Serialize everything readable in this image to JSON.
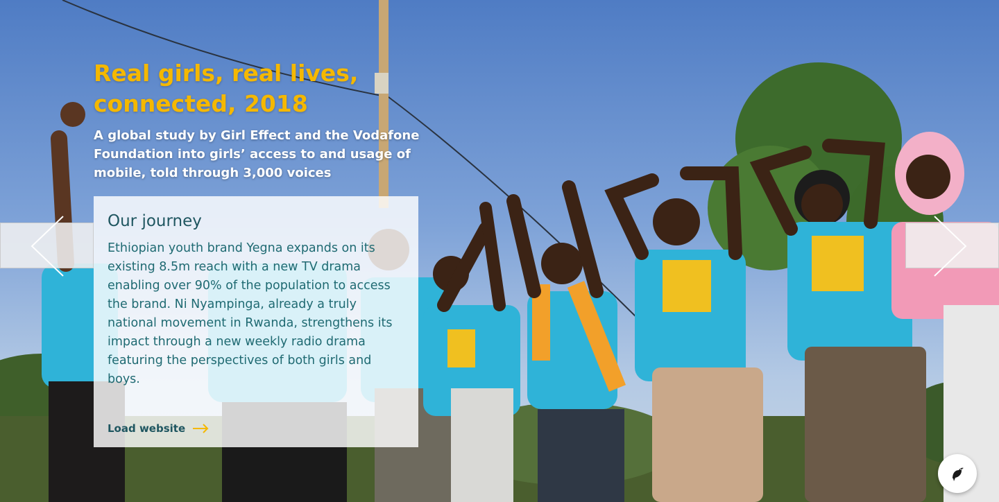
{
  "hero": {
    "headline": "Real girls, real lives, connected, 2018",
    "subheadline": "A global study by Girl Effect and the Vodafone Foundation into girls’ access to and usage of mobile, told through 3,000 voices"
  },
  "card": {
    "title": "Our journey",
    "body": "Ethiopian youth brand Yegna expands on its existing 8.5m reach with a new TV drama enabling over 90% of the population to access the brand. Ni Nyampinga, already a truly national movement in Rwanda, strengthens its impact through a new weekly radio drama featuring the perspectives of both girls and boys.",
    "link_label": "Load website"
  },
  "icons": {
    "prev": "chevron-left-icon",
    "next": "chevron-right-icon",
    "link_arrow": "arrow-right-icon",
    "fab": "bird-icon"
  },
  "colors": {
    "headline": "#f5b800",
    "subheadline": "#ffffff",
    "card_title": "#1f5660",
    "card_text": "#1f6a72",
    "accent": "#f5b800"
  }
}
